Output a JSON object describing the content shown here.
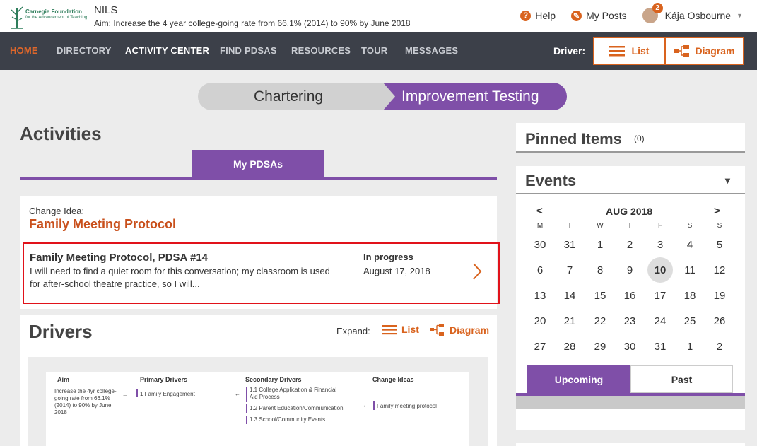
{
  "header": {
    "logo_line1": "Carnegie Foundation",
    "logo_line2": "for the Advancement of Teaching",
    "app_name": "NILS",
    "aim": "Aim:  Increase the 4 year college-going rate from 66.1% (2014) to 90% by June 2018",
    "help": "Help",
    "my_posts": "My Posts",
    "user_name": "Kája Osbourne",
    "notif_count": "2"
  },
  "nav": {
    "items": [
      "HOME",
      "DIRECTORY",
      "ACTIVITY CENTER",
      "FIND PDSAS",
      "RESOURCES",
      "TOUR",
      "MESSAGES"
    ],
    "driver_label": "Driver:",
    "list_btn": "List",
    "diagram_btn": "Diagram"
  },
  "phase": {
    "left": "Chartering",
    "right": "Improvement Testing"
  },
  "activities": {
    "title": "Activities",
    "tab": "My PDSAs",
    "change_idea_label": "Change Idea:",
    "change_idea_title": "Family Meeting Protocol",
    "pdsa": {
      "title": "Family Meeting Protocol, PDSA #14",
      "description": "I will need to find a quiet room for this conversation; my classroom is used for after-school theatre practice, so I will...",
      "status": "In progress",
      "date": "August 17, 2018"
    }
  },
  "drivers": {
    "title": "Drivers",
    "expand_label": "Expand:",
    "list": "List",
    "diagram": "Diagram",
    "diagram_preview": {
      "headers": [
        "Aim",
        "Primary Drivers",
        "Secondary Drivers",
        "Change Ideas"
      ],
      "aim_text": "Increase the 4yr college-going rate from 66.1% (2014) to 90% by June 2018",
      "primary": "1  Family Engagement",
      "secondary": [
        "1.1  College Application & Financial Aid Process",
        "1.2  Parent Education/Communication",
        "1.3  School/Community Events"
      ],
      "change_idea": "Family meeting protocol"
    }
  },
  "pinned": {
    "title": "Pinned Items",
    "count": "(0)"
  },
  "events": {
    "title": "Events",
    "month": "AUG 2018",
    "prev": "<",
    "next": ">",
    "weekdays": [
      "M",
      "T",
      "W",
      "T",
      "F",
      "S",
      "S"
    ],
    "weeks": [
      [
        "30",
        "31",
        "1",
        "2",
        "3",
        "4",
        "5"
      ],
      [
        "6",
        "7",
        "8",
        "9",
        "10",
        "11",
        "12"
      ],
      [
        "13",
        "14",
        "15",
        "16",
        "17",
        "18",
        "19"
      ],
      [
        "20",
        "21",
        "22",
        "23",
        "24",
        "25",
        "26"
      ],
      [
        "27",
        "28",
        "29",
        "30",
        "31",
        "1",
        "2"
      ]
    ],
    "selected_day": "10",
    "tab_upcoming": "Upcoming",
    "tab_past": "Past"
  },
  "colors": {
    "accent_orange": "#d9631e",
    "purple": "#7f4fa8",
    "nav_bg": "#3c4049"
  }
}
